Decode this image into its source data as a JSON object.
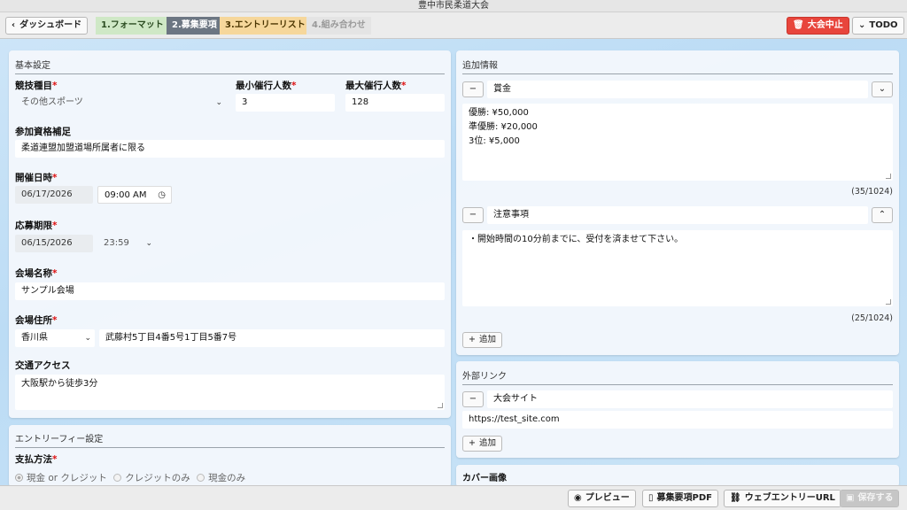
{
  "window": {
    "title": "豊中市民柔道大会"
  },
  "nav": {
    "back_label": "ダッシュボード",
    "steps": [
      {
        "label": "1.フォーマット"
      },
      {
        "label": "2.募集要項"
      },
      {
        "label": "3.エントリーリスト"
      },
      {
        "label": "4.組み合わせ"
      }
    ],
    "cancel_label": "大会中止",
    "todo_label": "TODO"
  },
  "basic": {
    "title": "基本設定",
    "sport_label": "競技種目",
    "sport_value": "その他スポーツ",
    "min_label": "最小催行人数",
    "min_value": "3",
    "max_label": "最大催行人数",
    "max_value": "128",
    "eligibility_label": "参加資格補足",
    "eligibility_value": "柔道連盟加盟道場所属者に限る",
    "date_label": "開催日時",
    "date_value": "06/17/2026",
    "time_value": "09:00 AM",
    "deadline_label": "応募期限",
    "deadline_date": "06/15/2026",
    "deadline_time": "23:59",
    "venue_label": "会場名称",
    "venue_value": "サンプル会場",
    "address_label": "会場住所",
    "prefecture": "香川県",
    "address_value": "武藤村5丁目4番5号1丁目5番7号",
    "access_label": "交通アクセス",
    "access_value": "大阪駅から徒歩3分",
    "required_mark": "*"
  },
  "fee": {
    "title": "エントリーフィー設定",
    "payment_label": "支払方法",
    "options": [
      "現金 or クレジット",
      "クレジットのみ",
      "現金のみ"
    ]
  },
  "additional": {
    "title": "追加情報",
    "items": [
      {
        "heading": "賞金",
        "lines": [
          "優勝: ¥50,000",
          "準優勝: ¥20,000",
          "3位: ¥5,000"
        ],
        "counter": "(35/1024)"
      },
      {
        "heading": "注意事項",
        "lines": [
          "・開始時間の10分前までに、受付を済ませて下さい。"
        ],
        "counter": "(25/1024)"
      }
    ],
    "add_label": "追加"
  },
  "links": {
    "title": "外部リンク",
    "heading": "大会サイト",
    "url": "https://test_site.com",
    "add_label": "追加"
  },
  "cover": {
    "title": "カバー画像"
  },
  "footer": {
    "preview_label": "プレビュー",
    "pdf_label": "募集要項PDF",
    "url_label": "ウェブエントリーURL",
    "save_label": "保存する"
  },
  "colors": {
    "step1": "#cfe8c6",
    "step2": "#6c7682",
    "step3": "#f6d79b",
    "step4": "#e4e4e4",
    "cancel": "#e8453c"
  }
}
